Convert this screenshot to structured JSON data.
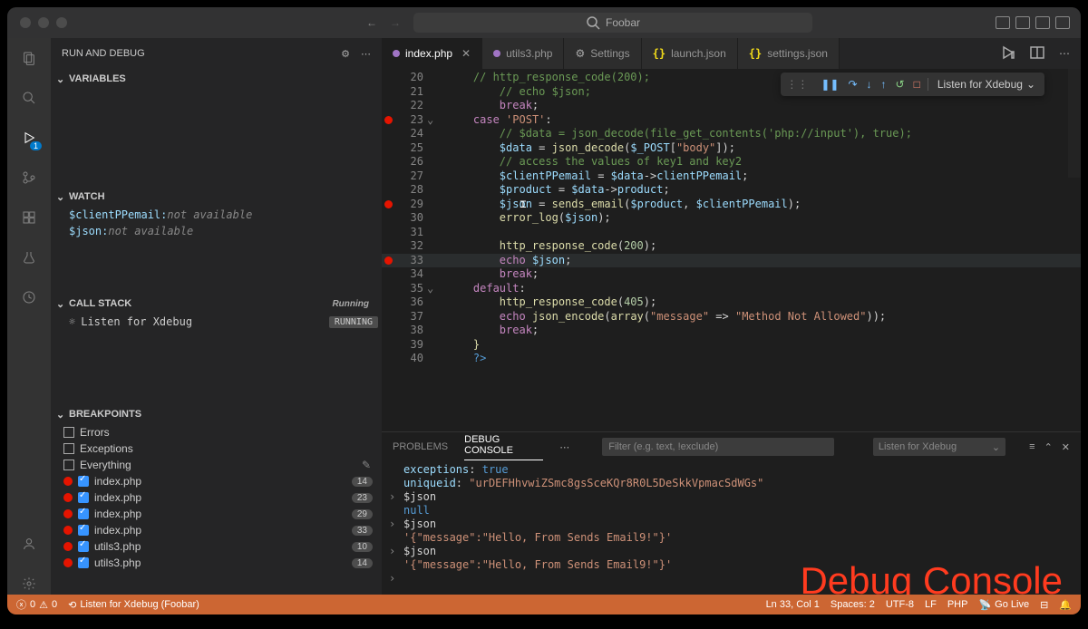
{
  "titlebar": {
    "search": "Foobar"
  },
  "sidebar": {
    "title": "RUN AND DEBUG",
    "sections": {
      "variables": "VARIABLES",
      "watch": "WATCH",
      "callstack": "CALL STACK",
      "breakpoints": "BREAKPOINTS"
    },
    "watch": [
      {
        "name": "$clientPPemail:",
        "val": " not available"
      },
      {
        "name": "$json:",
        "val": " not available"
      }
    ],
    "callstack": {
      "label": "Listen for Xdebug",
      "status": "Running",
      "badge": "RUNNING"
    },
    "breakpoints": [
      {
        "type": "check",
        "label": "Errors"
      },
      {
        "type": "check",
        "label": "Exceptions"
      },
      {
        "type": "check",
        "label": "Everything",
        "pencil": true
      },
      {
        "type": "bp",
        "label": "index.php",
        "count": "14"
      },
      {
        "type": "bp",
        "label": "index.php",
        "count": "23"
      },
      {
        "type": "bp",
        "label": "index.php",
        "count": "29"
      },
      {
        "type": "bp",
        "label": "index.php",
        "count": "33"
      },
      {
        "type": "bp",
        "label": "utils3.php",
        "count": "10"
      },
      {
        "type": "bp",
        "label": "utils3.php",
        "count": "14"
      }
    ]
  },
  "tabs": [
    {
      "label": "index.php",
      "icon": "php",
      "active": true,
      "close": true
    },
    {
      "label": "utils3.php",
      "icon": "php"
    },
    {
      "label": "Settings",
      "icon": "gear"
    },
    {
      "label": "launch.json",
      "icon": "json"
    },
    {
      "label": "settings.json",
      "icon": "json"
    }
  ],
  "debugToolbar": {
    "config": "Listen for Xdebug"
  },
  "code": [
    {
      "n": 20,
      "bp": false,
      "fold": "",
      "txt": "<span class='c'>// http_response_code(200);</span>"
    },
    {
      "n": 21,
      "bp": false,
      "fold": "",
      "txt": "    <span class='c'>// echo $json;</span>"
    },
    {
      "n": 22,
      "bp": false,
      "fold": "",
      "txt": "    <span class='k'>break</span><span class='p'>;</span>"
    },
    {
      "n": 23,
      "bp": true,
      "fold": "⌄",
      "txt": "<span class='k'>case</span> <span class='s'>'POST'</span><span class='p'>:</span>"
    },
    {
      "n": 24,
      "bp": false,
      "fold": "",
      "txt": "    <span class='c'>// $data = json_decode(file_get_contents('php://input'), true);</span>"
    },
    {
      "n": 25,
      "bp": false,
      "fold": "",
      "txt": "    <span class='v'>$data</span> <span class='p'>=</span> <span class='f'>json_decode</span><span class='p'>(</span><span class='v'>$_POST</span><span class='p'>[</span><span class='s'>\"body\"</span><span class='p'>]);</span>"
    },
    {
      "n": 26,
      "bp": false,
      "fold": "",
      "txt": "    <span class='c'>// access the values of key1 and key2</span>"
    },
    {
      "n": 27,
      "bp": false,
      "fold": "",
      "txt": "    <span class='v'>$clientPPemail</span> <span class='p'>=</span> <span class='v'>$data</span><span class='p'>-></span><span class='v'>clientPPemail</span><span class='p'>;</span>"
    },
    {
      "n": 28,
      "bp": false,
      "fold": "",
      "txt": "    <span class='v'>$product</span> <span class='p'>=</span> <span class='v'>$data</span><span class='p'>-></span><span class='v'>product</span><span class='p'>;</span>"
    },
    {
      "n": 29,
      "bp": true,
      "fold": "",
      "txt": "    <span class='v'>$json</span> <span class='p'>=</span> <span class='f'>sends_email</span><span class='p'>(</span><span class='v'>$product</span><span class='p'>,</span> <span class='v'>$clientPPemail</span><span class='p'>);</span>",
      "cursor": true
    },
    {
      "n": 30,
      "bp": false,
      "fold": "",
      "txt": "    <span class='f'>error_log</span><span class='p'>(</span><span class='v'>$json</span><span class='p'>);</span>"
    },
    {
      "n": 31,
      "bp": false,
      "fold": "",
      "txt": ""
    },
    {
      "n": 32,
      "bp": false,
      "fold": "",
      "txt": "    <span class='f'>http_response_code</span><span class='p'>(</span><span class='n'>200</span><span class='p'>);</span>"
    },
    {
      "n": 33,
      "bp": true,
      "fold": "",
      "txt": "    <span class='k'>echo</span> <span class='v'>$json</span><span class='p'>;</span>",
      "hl": true
    },
    {
      "n": 34,
      "bp": false,
      "fold": "",
      "txt": "    <span class='k'>break</span><span class='p'>;</span>"
    },
    {
      "n": 35,
      "bp": false,
      "fold": "⌄",
      "txt": "<span class='k'>default</span><span class='p'>:</span>"
    },
    {
      "n": 36,
      "bp": false,
      "fold": "",
      "txt": "    <span class='f'>http_response_code</span><span class='p'>(</span><span class='n'>405</span><span class='p'>);</span>"
    },
    {
      "n": 37,
      "bp": false,
      "fold": "",
      "txt": "    <span class='k'>echo</span> <span class='f'>json_encode</span><span class='p'>(</span><span class='f'>array</span><span class='p'>(</span><span class='s'>\"message\"</span> <span class='p'>=></span> <span class='s'>\"Method Not Allowed\"</span><span class='p'>));</span>"
    },
    {
      "n": 38,
      "bp": false,
      "fold": "",
      "txt": "    <span class='k'>break</span><span class='p'>;</span>"
    },
    {
      "n": 39,
      "bp": false,
      "fold": "",
      "txt": "<span class='f'>}</span>"
    },
    {
      "n": 40,
      "bp": false,
      "fold": "",
      "txt": "<span class='b'>?></span>"
    }
  ],
  "arrows": [
    108,
    202,
    265
  ],
  "panel": {
    "tabs": {
      "problems": "PROBLEMS",
      "debug": "DEBUG CONSOLE"
    },
    "filterPlaceholder": "Filter (e.g. text, !exclude)",
    "listen": "Listen for Xdebug",
    "console": [
      {
        "txt": "  <span class='v'>exceptions</span><span class='p'>:</span> <span class='b'>true</span>"
      },
      {
        "txt": "  <span class='v'>uniqueid</span><span class='p'>:</span> <span class='s'>\"urDEFHhvwiZSmc8gsSceKQr8R0L5DeSkkVpmacSdWGs\"</span>"
      },
      {
        "ar": "›",
        "txt": "<span class='p'>$json</span>"
      },
      {
        "txt": "<span class='b'>null</span>"
      },
      {
        "ar": "›",
        "txt": "<span class='p'>$json</span>"
      },
      {
        "txt": "<span class='s'>'{\"message\":\"Hello, From Sends Email9!\"}'</span>"
      },
      {
        "ar": "›",
        "txt": "<span class='p'>$json</span>"
      },
      {
        "txt": "<span class='s'>'{\"message\":\"Hello, From Sends Email9!\"}'</span>"
      },
      {
        "ar": "›",
        "txt": ""
      }
    ],
    "annotation": "Debug Console"
  },
  "status": {
    "errors": "0",
    "warnings": "0",
    "config": "Listen for Xdebug (Foobar)",
    "ln": "Ln 33, Col 1",
    "spaces": "Spaces: 2",
    "enc": "UTF-8",
    "eol": "LF",
    "lang": "PHP",
    "live": "Go Live"
  }
}
